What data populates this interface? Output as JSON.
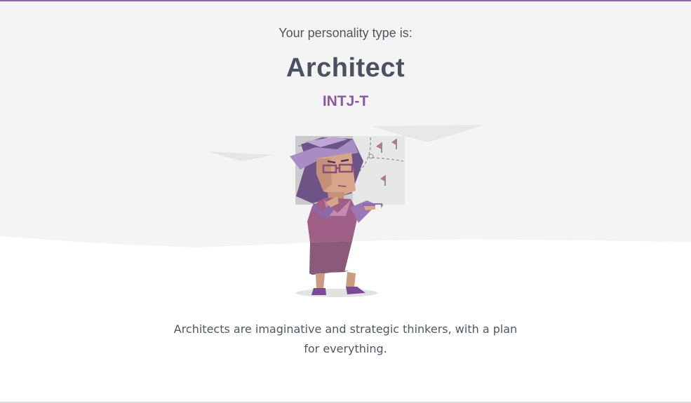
{
  "result": {
    "intro": "Your personality type is:",
    "type_name": "Architect",
    "type_code": "INTJ-T",
    "description": "Architects are imaginative and strategic thinkers, with a plan for everything."
  },
  "colors": {
    "accent": "#8a5a9e",
    "heading": "#4a5160",
    "text": "#4f5663",
    "hero_background": "#f4f4f5"
  },
  "illustration": {
    "subject": "architect-character-icon"
  }
}
